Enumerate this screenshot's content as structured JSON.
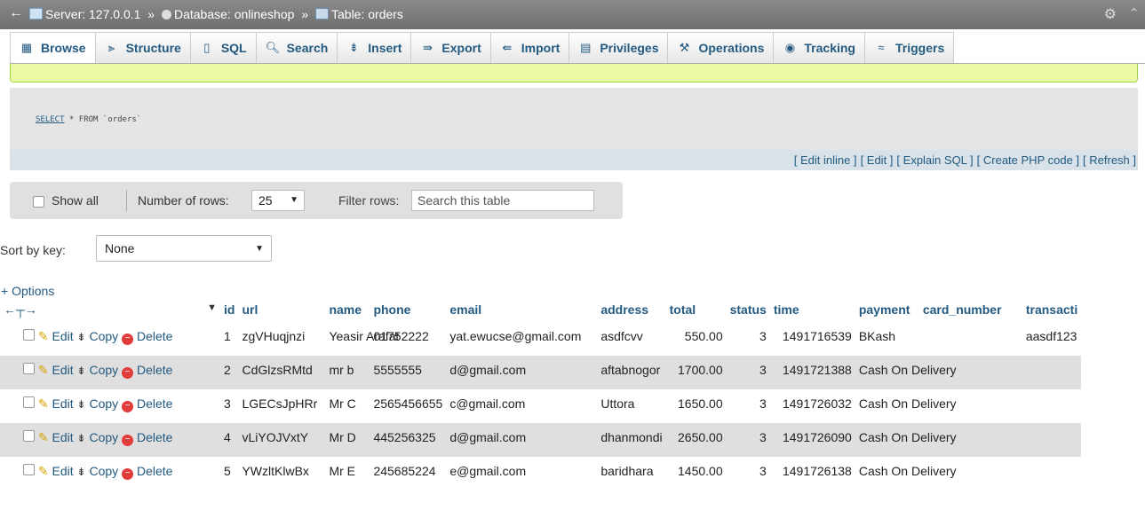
{
  "breadcrumb": {
    "server_label": "Server: 127.0.0.1",
    "database_label": "Database: onlineshop",
    "table_label": "Table: orders",
    "separator": "»"
  },
  "tabs": [
    {
      "label": "Browse",
      "icon": "table-icon"
    },
    {
      "label": "Structure",
      "icon": "structure-icon"
    },
    {
      "label": "SQL",
      "icon": "sql-icon"
    },
    {
      "label": "Search",
      "icon": "search-icon"
    },
    {
      "label": "Insert",
      "icon": "insert-icon"
    },
    {
      "label": "Export",
      "icon": "export-icon"
    },
    {
      "label": "Import",
      "icon": "import-icon"
    },
    {
      "label": "Privileges",
      "icon": "privileges-icon"
    },
    {
      "label": "Operations",
      "icon": "wrench-icon"
    },
    {
      "label": "Tracking",
      "icon": "eye-icon"
    },
    {
      "label": "Triggers",
      "icon": "triggers-icon"
    }
  ],
  "sql": {
    "keyword": "SELECT",
    "rest": " * FROM `orders`",
    "actions": [
      "[ Edit inline ]",
      "[ Edit ]",
      "[ Explain SQL ]",
      "[ Create PHP code ]",
      "[ Refresh ]"
    ]
  },
  "filter": {
    "show_all_label": "Show all",
    "number_of_rows_label": "Number of rows:",
    "rows_value": "25",
    "filter_rows_label": "Filter rows:",
    "search_placeholder": "Search this table"
  },
  "sort": {
    "label": "Sort by key:",
    "value": "None"
  },
  "options_label": "+ Options",
  "table": {
    "columns": [
      "id",
      "url",
      "name",
      "phone",
      "email",
      "address",
      "total",
      "status",
      "time",
      "payment",
      "card_number",
      "transacti"
    ],
    "action_labels": {
      "edit": "Edit",
      "copy": "Copy",
      "delete": "Delete"
    },
    "rows": [
      {
        "id": "1",
        "url": "zgVHuqjnzi",
        "name": "Yeasir Arafat",
        "phone": "01752222",
        "email": "yat.ewucse@gmail.com",
        "address": "asdfcvv",
        "total": "550.00",
        "status": "3",
        "time": "1491716539",
        "payment": "BKash",
        "card_number": "",
        "transaction": "aasdf123"
      },
      {
        "id": "2",
        "url": "CdGlzsRMtd",
        "name": "mr b",
        "phone": "5555555",
        "email": "d@gmail.com",
        "address": "aftabnogor",
        "total": "1700.00",
        "status": "3",
        "time": "1491721388",
        "payment": "Cash On Delivery",
        "card_number": "",
        "transaction": ""
      },
      {
        "id": "3",
        "url": "LGECsJpHRr",
        "name": "Mr C",
        "phone": "2565456655",
        "email": "c@gmail.com",
        "address": "Uttora",
        "total": "1650.00",
        "status": "3",
        "time": "1491726032",
        "payment": "Cash On Delivery",
        "card_number": "",
        "transaction": ""
      },
      {
        "id": "4",
        "url": "vLiYOJVxtY",
        "name": "Mr D",
        "phone": "445256325",
        "email": "d@gmail.com",
        "address": "dhanmondi",
        "total": "2650.00",
        "status": "3",
        "time": "1491726090",
        "payment": "Cash On Delivery",
        "card_number": "",
        "transaction": ""
      },
      {
        "id": "5",
        "url": "YWzltKlwBx",
        "name": "Mr E",
        "phone": "245685224",
        "email": "e@gmail.com",
        "address": "baridhara",
        "total": "1450.00",
        "status": "3",
        "time": "1491726138",
        "payment": "Cash On Delivery",
        "card_number": "",
        "transaction": ""
      }
    ]
  }
}
